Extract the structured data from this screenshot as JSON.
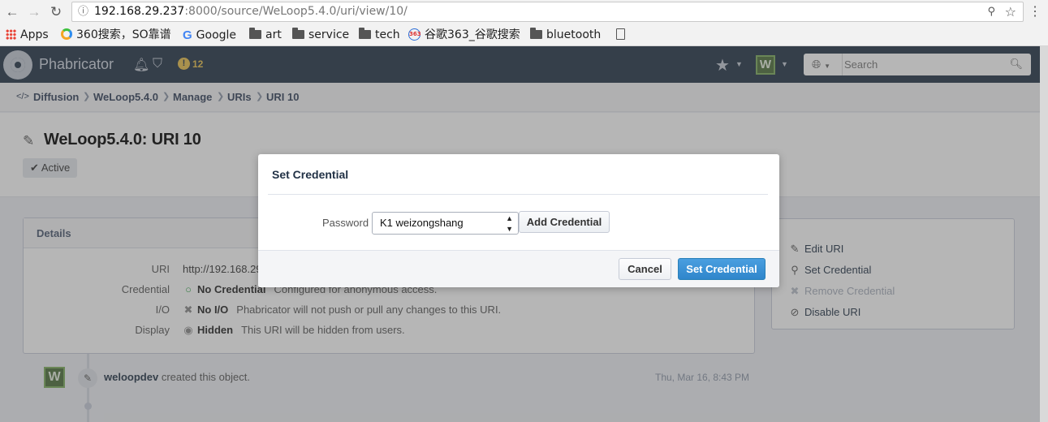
{
  "browser": {
    "url_host": "192.168.29.237",
    "url_rest": ":8000/source/WeLoop5.4.0/uri/view/10/",
    "bookmarks": [
      "Apps",
      "360搜索，SO靠谱",
      "Google",
      "art",
      "service",
      "tech",
      "谷歌363_谷歌搜索",
      "bluetooth"
    ]
  },
  "app": {
    "name": "Phabricator",
    "notification_count": "12",
    "search_placeholder": "Search",
    "avatar_letter": "W"
  },
  "breadcrumbs": [
    "Diffusion",
    "WeLoop5.4.0",
    "Manage",
    "URIs",
    "URI 10"
  ],
  "page": {
    "title": "WeLoop5.4.0: URI 10",
    "status": "Active"
  },
  "details": {
    "heading": "Details",
    "rows": [
      {
        "label": "URI",
        "value": "http://192.168.29",
        "desc": ""
      },
      {
        "label": "Credential",
        "value": "No Credential",
        "desc": "Configured for anonymous access."
      },
      {
        "label": "I/O",
        "value": "No I/O",
        "desc": "Phabricator will not push or pull any changes to this URI."
      },
      {
        "label": "Display",
        "value": "Hidden",
        "desc": "This URI will be hidden from users."
      }
    ]
  },
  "actions": [
    {
      "label": "Edit URI",
      "icon": "pencil-icon",
      "enabled": true
    },
    {
      "label": "Set Credential",
      "icon": "key-icon",
      "enabled": true
    },
    {
      "label": "Remove Credential",
      "icon": "times-icon",
      "enabled": false
    },
    {
      "label": "Disable URI",
      "icon": "ban-icon",
      "enabled": true
    }
  ],
  "timeline": {
    "author": "weloopdev",
    "text": "created this object.",
    "date": "Thu, Mar 16, 8:43 PM"
  },
  "dialog": {
    "title": "Set Credential",
    "password_label": "Password",
    "selected_credential": "K1 weizongshang",
    "add_button": "Add Credential",
    "cancel_button": "Cancel",
    "submit_button": "Set Credential"
  },
  "colors": {
    "nav_bar": "#223246",
    "primary_button": "#2f86cb",
    "green_check": "#2ea043"
  }
}
